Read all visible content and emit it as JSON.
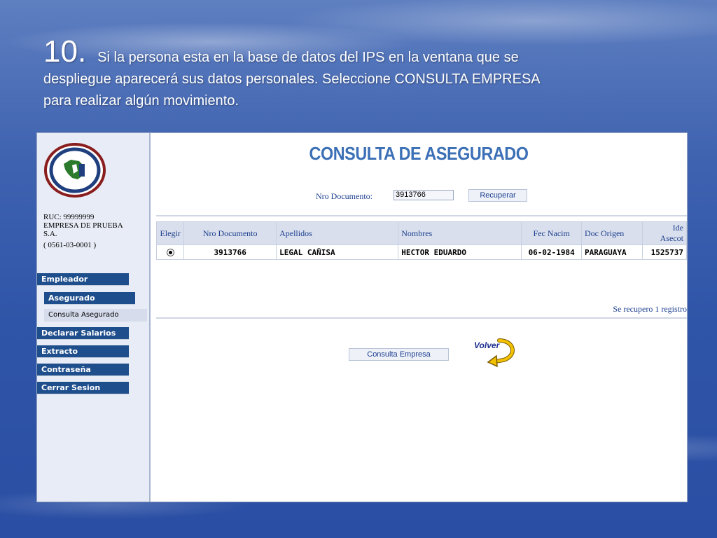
{
  "slide": {
    "number": "10.",
    "text_line1": "Si la persona esta en la base de datos del IPS en la ventana que se",
    "text_line2": "despliegue aparecerá sus datos personales. Seleccione CONSULTA EMPRESA",
    "text_line3": "para realizar algún movimiento."
  },
  "sidebar": {
    "logo_icon": "ips-seal-logo",
    "company": {
      "ruc": "RUC: 99999999",
      "name_line1": "EMPRESA DE PRUEBA",
      "name_line2": "S.A.",
      "code": "( 0561-03-0001 )"
    },
    "menu": {
      "empleador": "Empleador",
      "asegurado": "Asegurado",
      "consulta_asegurado": "Consulta Asegurado",
      "declarar_salarios": "Declarar Salarios",
      "extracto": "Extracto",
      "contrasena": "Contraseña",
      "cerrar_sesion": "Cerrar Sesion"
    }
  },
  "main": {
    "title": "CONSULTA DE ASEGURADO",
    "search": {
      "label": "Nro Documento:",
      "value": "3913766",
      "button": "Recuperar"
    },
    "table": {
      "headers": {
        "elegir": "Elegir",
        "nro_documento": "Nro Documento",
        "apellidos": "Apellidos",
        "nombres": "Nombres",
        "fec_nacim": "Fec Nacim",
        "doc_origen": "Doc Origen",
        "ide_line1": "Ide",
        "ide_line2": "Asecot"
      },
      "rows": [
        {
          "selected": true,
          "nro_documento": "3913766",
          "apellidos": "LEGAL CAÑISA",
          "nombres": "HECTOR EDUARDO",
          "fec_nacim": "06-02-1984",
          "doc_origen": "PARAGUAYA",
          "ide_asecot": "1525737"
        }
      ]
    },
    "status": "Se recupero 1 registro",
    "consult_button": "Consulta Empresa",
    "back_label": "Volver",
    "back_icon": "curved-back-arrow-icon",
    "colors": {
      "accent": "#1f4e8c",
      "title": "#3b6fb6",
      "link_text": "#1d3f8f",
      "back_arrow": "#f2c200"
    }
  }
}
